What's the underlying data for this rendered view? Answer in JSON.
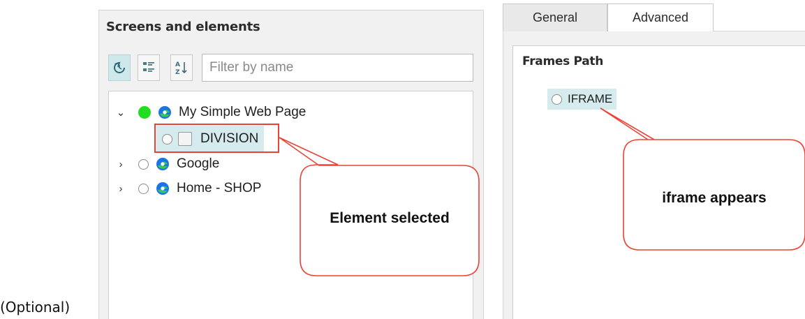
{
  "left_panel": {
    "title": "Screens and elements",
    "toolbar": {
      "refresh_icon": "refresh-icon",
      "group_icon": "group-by-icon",
      "sort_icon": "sort-az-icon"
    },
    "filter": {
      "placeholder": "Filter by name",
      "value": ""
    },
    "tree": [
      {
        "label": "My Simple Web Page",
        "expanded": true,
        "status": "active",
        "icon": "edge-browser-icon"
      },
      {
        "label": "DIVISION",
        "child": true,
        "selected": true,
        "icon": "checkbox-icon"
      },
      {
        "label": "Google",
        "expanded": false,
        "icon": "edge-browser-icon"
      },
      {
        "label": "Home - SHOP",
        "expanded": false,
        "icon": "edge-browser-icon"
      }
    ]
  },
  "right_panel": {
    "tabs": [
      {
        "label": "General",
        "active": false
      },
      {
        "label": "Advanced",
        "active": true
      }
    ],
    "frames_path": {
      "title": "Frames Path",
      "items": [
        {
          "label": "IFRAME"
        }
      ]
    }
  },
  "callouts": {
    "left": "Element selected",
    "right": "iframe appears"
  },
  "footer": {
    "optional_label": "(Optional)"
  },
  "colors": {
    "active_status": "#22dd22",
    "selection_bg": "#d5ebee",
    "callout_border": "#ea4335",
    "edge_blue": "#1a73e8",
    "edge_green": "#34c759"
  }
}
